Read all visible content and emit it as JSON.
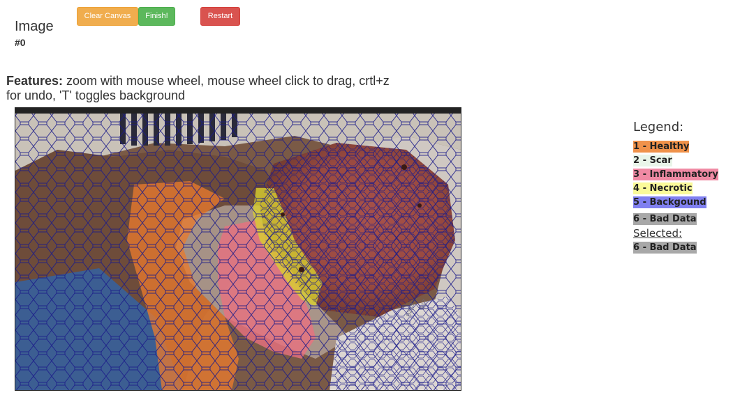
{
  "toolbar": {
    "clear_label": "Clear Canvas",
    "finish_label": "Finish!",
    "restart_label": "Restart"
  },
  "image_info": {
    "label": "Image",
    "number": "#0"
  },
  "features": {
    "heading": "Features:",
    "text": " zoom with mouse wheel, mouse wheel click to drag, crtl+z for undo, 'T' toggles background"
  },
  "legend": {
    "title": "Legend:",
    "items": [
      {
        "label": "1 - Healthy",
        "color": "#f0924a"
      },
      {
        "label": "2 - Scar",
        "color": "#e9f5e9"
      },
      {
        "label": "3 - Inflammatory",
        "color": "#f08aa4"
      },
      {
        "label": "4 - Necrotic",
        "color": "#fafa99"
      },
      {
        "label": "5 - Backgound",
        "color": "#8080f0"
      },
      {
        "label": "6 - Bad Data",
        "color": "#a8a8a8"
      }
    ],
    "selected_title": "Selected:",
    "selected_value": "6 - Bad Data",
    "selected_color": "#a8a8a8"
  },
  "canvas": {
    "overlay_colors": {
      "healthy": "#e87a2e",
      "inflammatory": "#e8707f",
      "necrotic": "#d8d030",
      "outline": "#1b1b8a"
    }
  }
}
